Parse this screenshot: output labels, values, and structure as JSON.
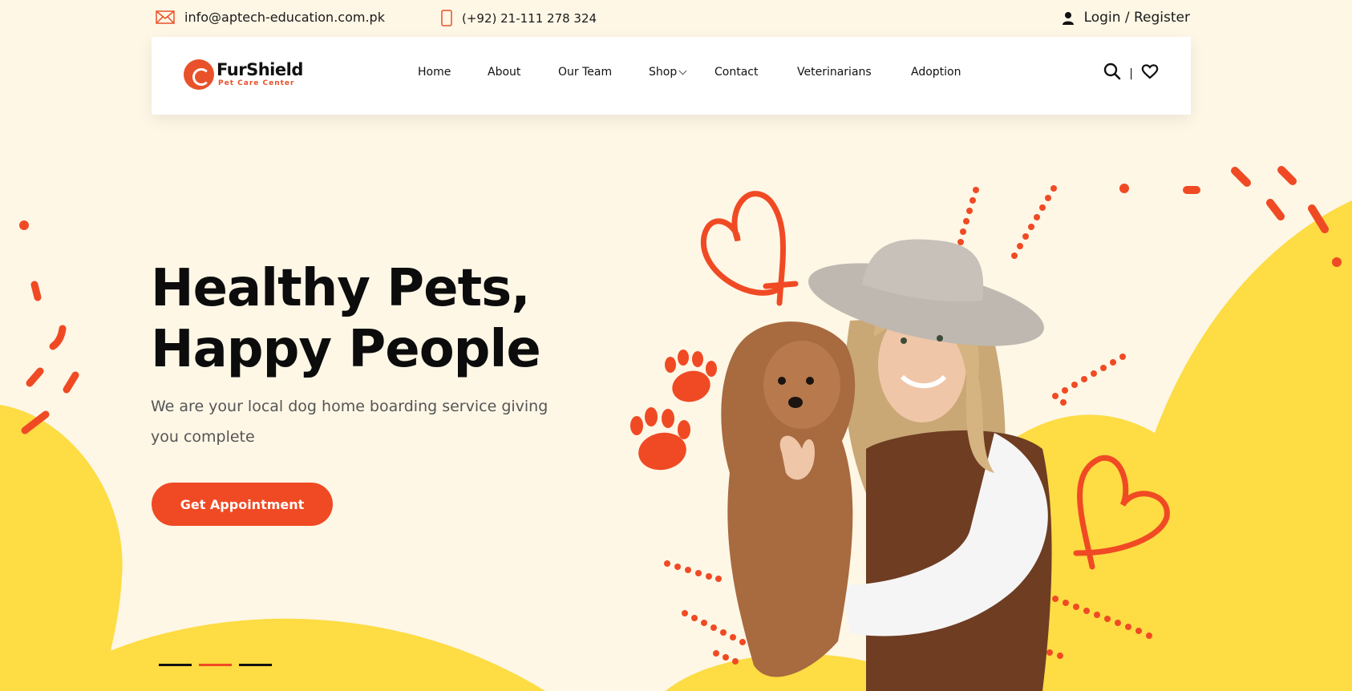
{
  "topbar": {
    "email": "info@aptech-education.com.pk",
    "phone": "(+92) 21-111 278 324",
    "login": "Login / Register",
    "icons": {
      "email": "envelope-icon",
      "phone": "mobile-phone-icon",
      "user": "user-icon"
    }
  },
  "logo": {
    "name": "FurShield",
    "tagline": "Pet Care Center"
  },
  "nav": {
    "items": [
      {
        "label": "Home"
      },
      {
        "label": "About"
      },
      {
        "label": "Our Team"
      },
      {
        "label": "Shop"
      },
      {
        "label": "Contact"
      },
      {
        "label": "Veterinarians"
      },
      {
        "label": "Adoption"
      }
    ],
    "separator": "|",
    "icons": {
      "search": "search-icon",
      "wishlist": "heart-icon"
    }
  },
  "hero": {
    "title_line1": "Healthy Pets,",
    "title_line2": "Happy People",
    "subtitle": "We are your local dog home boarding service giving you complete",
    "cta": "Get Appointment",
    "slides": 3,
    "active_slide": 2
  },
  "colors": {
    "background": "#fef7e6",
    "accent": "#f04a24",
    "yellow": "#fddc44",
    "text": "#111111"
  }
}
